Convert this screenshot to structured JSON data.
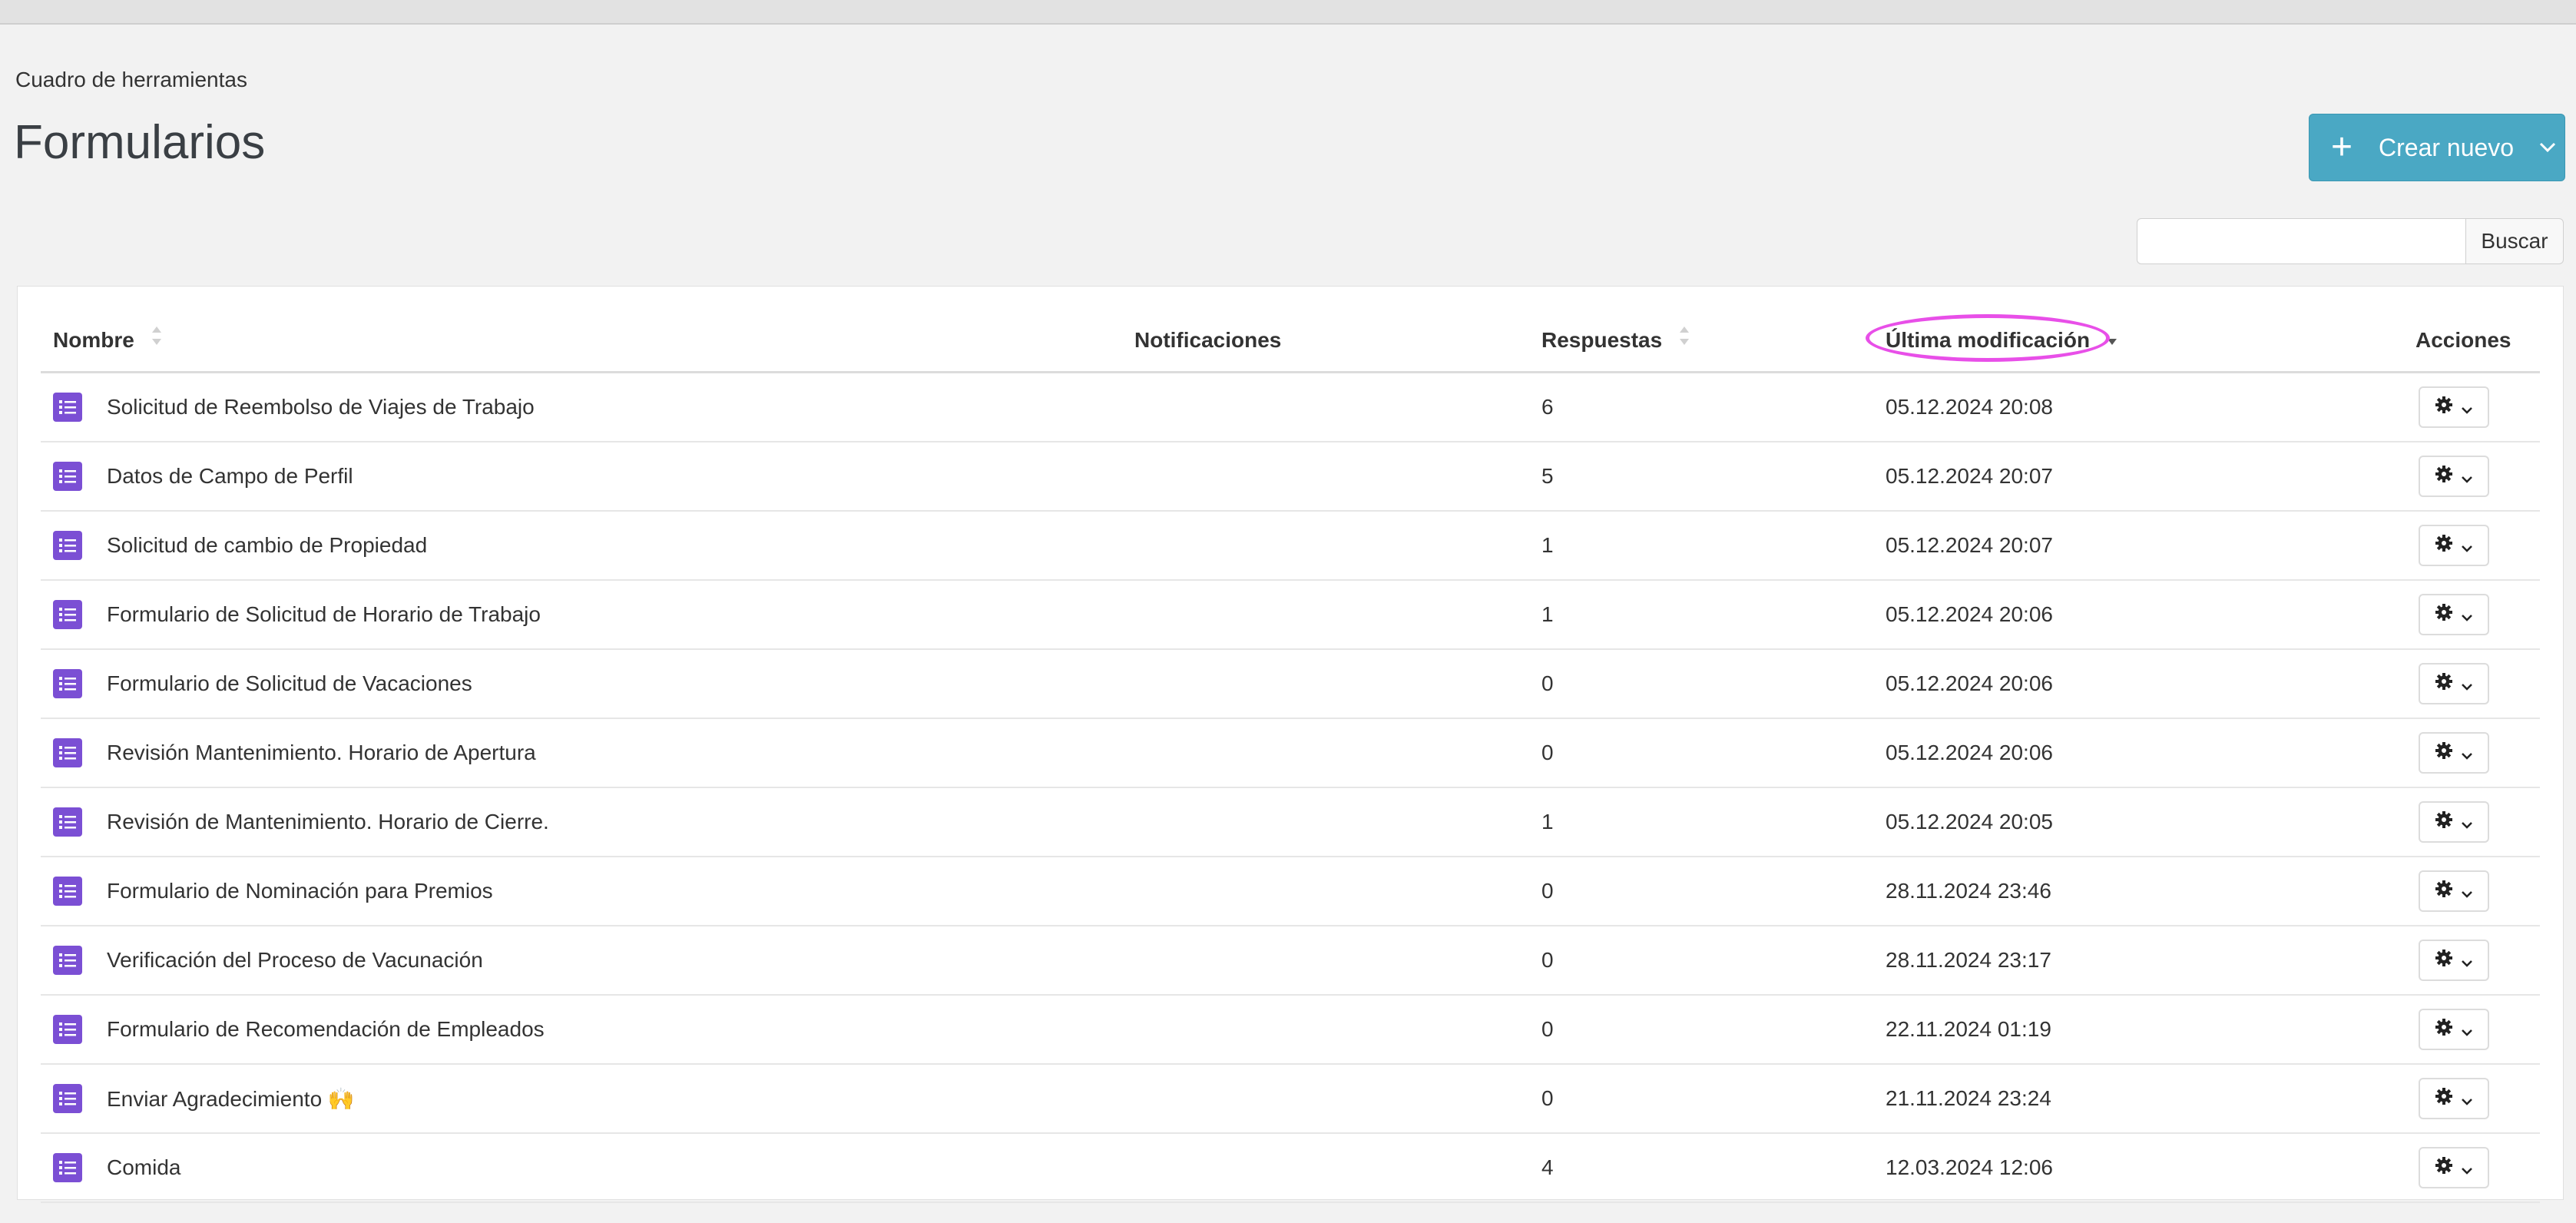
{
  "breadcrumb": "Cuadro de herramientas",
  "page_title": "Formularios",
  "create_button": {
    "label": "Crear nuevo"
  },
  "search": {
    "value": "",
    "placeholder": "",
    "button_label": "Buscar"
  },
  "table": {
    "headers": {
      "name": "Nombre",
      "notifications": "Notificaciones",
      "responses": "Respuestas",
      "last_modified": "Última modificación",
      "actions": "Acciones"
    },
    "rows": [
      {
        "name": "Solicitud de Reembolso de Viajes de Trabajo",
        "notifications": "",
        "responses": "6",
        "last_modified": "05.12.2024 20:08"
      },
      {
        "name": "Datos de Campo de Perfil",
        "notifications": "",
        "responses": "5",
        "last_modified": "05.12.2024 20:07"
      },
      {
        "name": "Solicitud de cambio de Propiedad",
        "notifications": "",
        "responses": "1",
        "last_modified": "05.12.2024 20:07"
      },
      {
        "name": "Formulario de Solicitud de Horario de Trabajo",
        "notifications": "",
        "responses": "1",
        "last_modified": "05.12.2024 20:06"
      },
      {
        "name": "Formulario de Solicitud de Vacaciones",
        "notifications": "",
        "responses": "0",
        "last_modified": "05.12.2024 20:06"
      },
      {
        "name": "Revisión Mantenimiento. Horario de Apertura",
        "notifications": "",
        "responses": "0",
        "last_modified": "05.12.2024 20:06"
      },
      {
        "name": "Revisión de Mantenimiento. Horario de Cierre.",
        "notifications": "",
        "responses": "1",
        "last_modified": "05.12.2024 20:05"
      },
      {
        "name": "Formulario de Nominación para Premios",
        "notifications": "",
        "responses": "0",
        "last_modified": "28.11.2024 23:46"
      },
      {
        "name": "Verificación del Proceso de Vacunación",
        "notifications": "",
        "responses": "0",
        "last_modified": "28.11.2024 23:17"
      },
      {
        "name": "Formulario de Recomendación de Empleados",
        "notifications": "",
        "responses": "0",
        "last_modified": "22.11.2024 01:19"
      },
      {
        "name": "Enviar Agradecimiento 🙌",
        "notifications": "",
        "responses": "0",
        "last_modified": "21.11.2024 23:24"
      },
      {
        "name": "Comida",
        "notifications": "",
        "responses": "4",
        "last_modified": "12.03.2024 12:06"
      }
    ]
  },
  "icons": {
    "row_icon": "list-icon",
    "action_icon": "gear-icon",
    "dropdown_icon": "chevron-down-icon",
    "create_icon": "plus-icon",
    "sort_icon": "sort-icon"
  },
  "colors": {
    "accent": "#4aa8c4",
    "form_icon": "#7b4fd4",
    "highlight": "#e84fe8",
    "background": "#f2f2f2"
  }
}
